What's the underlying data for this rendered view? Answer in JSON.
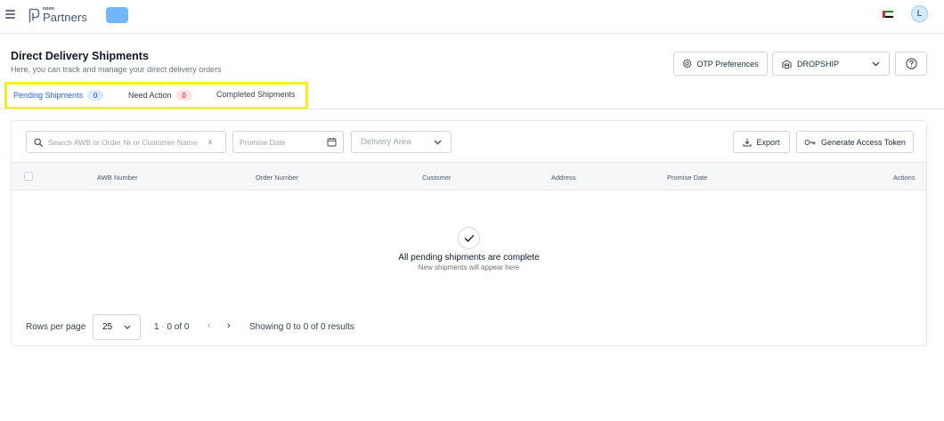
{
  "topbar": {
    "logo_small": "noon",
    "logo_big": "Partners",
    "flag": "uae-flag",
    "user_initial": "L"
  },
  "header": {
    "title": "Direct Delivery Shipments",
    "subtitle": "Here, you can track and manage your direct delivery orders",
    "otp_label": "OTP Preferences",
    "mode_label": "DROPSHIP"
  },
  "tabs": [
    {
      "label": "Pending Shipments",
      "count": "0",
      "active": true
    },
    {
      "label": "Need Action",
      "count": "0",
      "active": false
    },
    {
      "label": "Completed Shipments",
      "active": false
    }
  ],
  "filters": {
    "search_placeholder": "Search AWB or Order Nr or Customer Name",
    "search_clear": "x",
    "date_placeholder": "Promise Date",
    "area_placeholder": "Delivery Area",
    "export_label": "Export",
    "token_label": "Generate Access Token"
  },
  "table": {
    "columns": [
      "AWB Number",
      "Order Number",
      "Customer",
      "Address",
      "Promise Date",
      "Actions"
    ]
  },
  "empty_state": {
    "title": "All pending shipments are complete",
    "subtitle": "New shipments will appear here"
  },
  "pagination": {
    "rows_label": "Rows per page",
    "rows_value": "25",
    "range_start": "1",
    "range_sep": " - ",
    "range_text": "0 of 0",
    "showing": "Showing 0 to 0 of 0 results"
  },
  "colors": {
    "accent": "#2563eb",
    "highlight": "#f5f21a",
    "store_pill": "#6fb7f8"
  }
}
